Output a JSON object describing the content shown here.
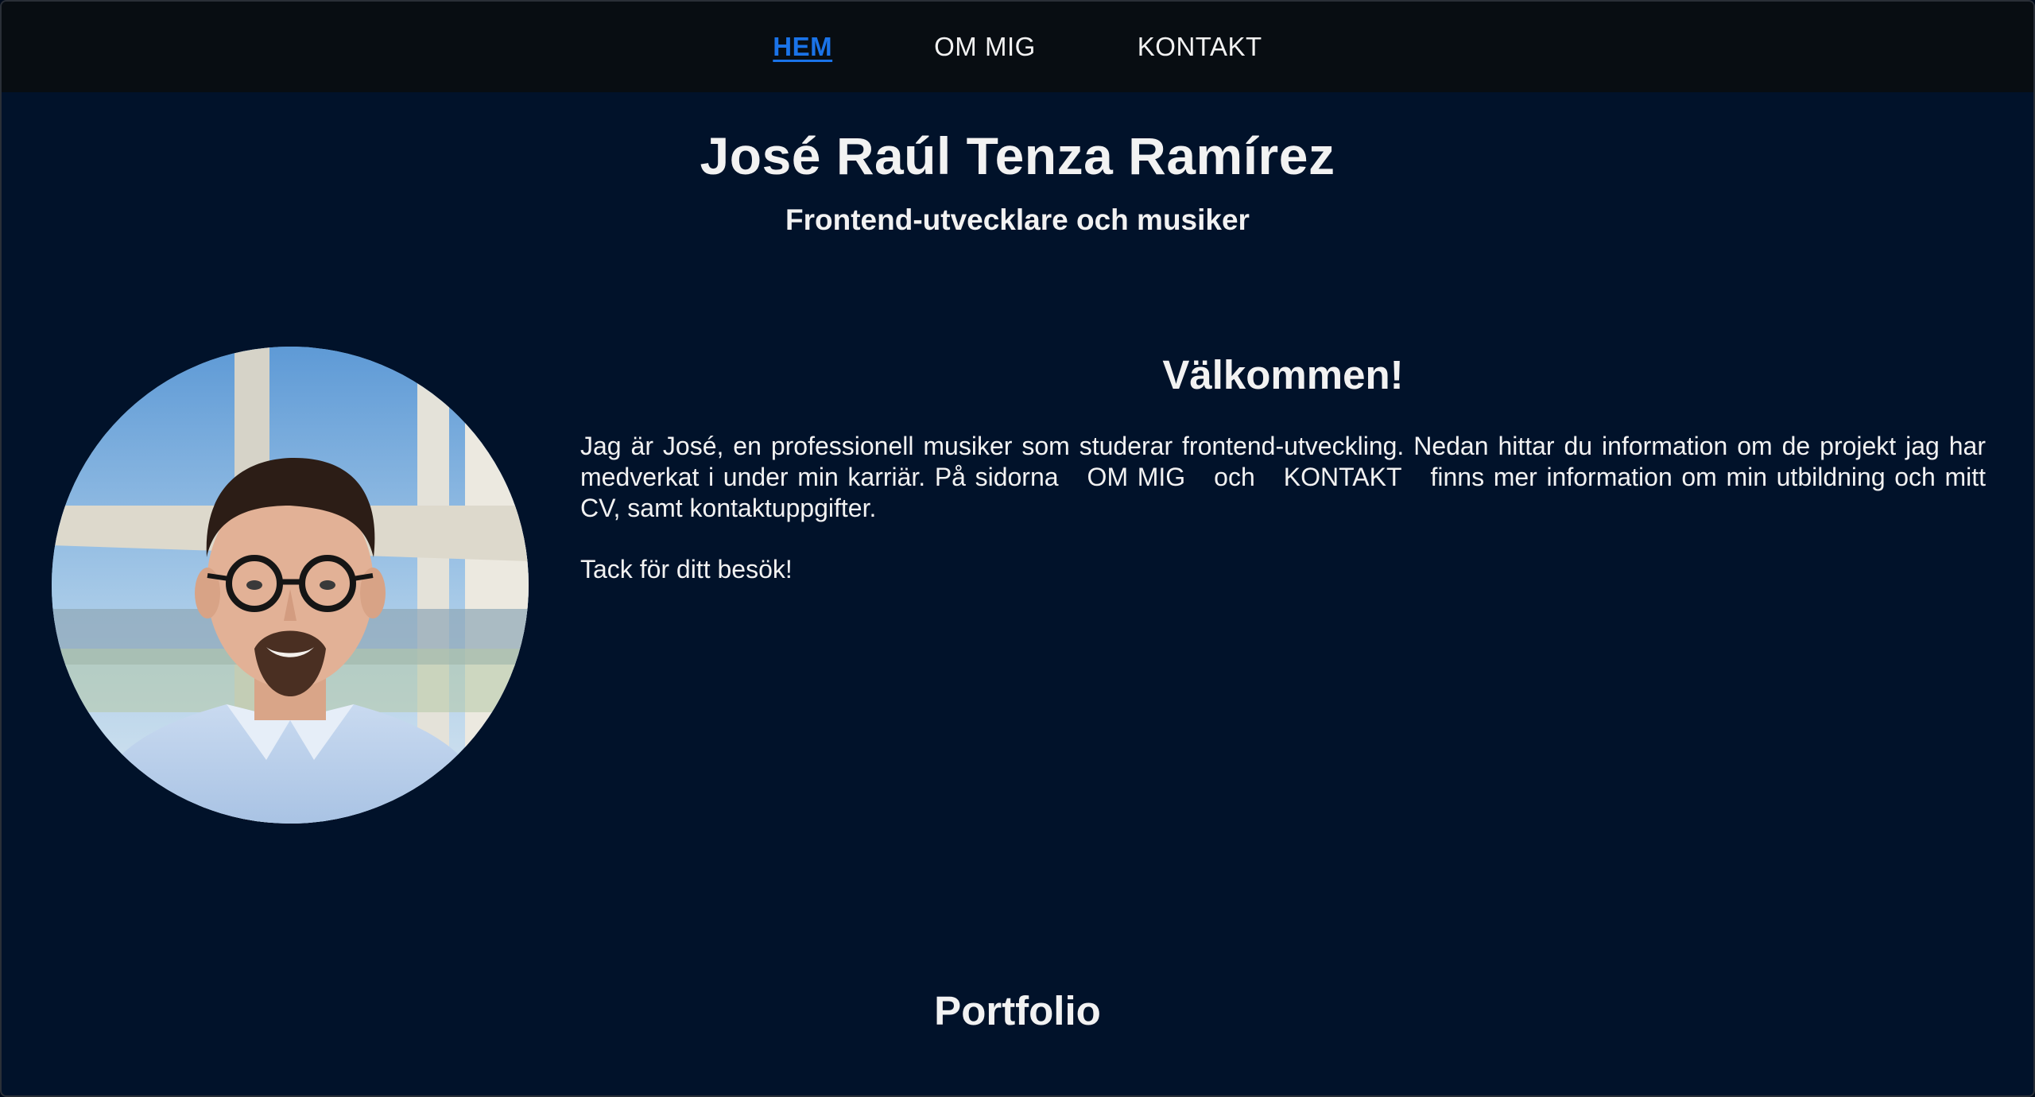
{
  "nav": {
    "items": [
      {
        "label": "HEM",
        "active": true
      },
      {
        "label": "OM MIG",
        "active": false
      },
      {
        "label": "KONTAKT",
        "active": false
      }
    ]
  },
  "header": {
    "name": "José Raúl Tenza Ramírez",
    "subtitle": "Frontend-utvecklare och musiker"
  },
  "welcome": {
    "title": "Välkommen!",
    "text_part1": "Jag är José, en professionell musiker som studerar frontend-utveckling. Nedan hittar du information om de projekt jag har medverkat i under min karriär. På sidorna",
    "link1": "OM MIG",
    "text_part2": "och",
    "link2": "KONTAKT",
    "text_part3": "finns mer information om min utbildning och mitt CV, samt kontaktuppgifter.",
    "thanks": "Tack för ditt besök!"
  },
  "portfolio": {
    "title": "Portfolio"
  },
  "colors": {
    "background": "#01122a",
    "navbar": "#080d12",
    "active_link": "#1a73e8",
    "text": "#f2f2f2"
  }
}
